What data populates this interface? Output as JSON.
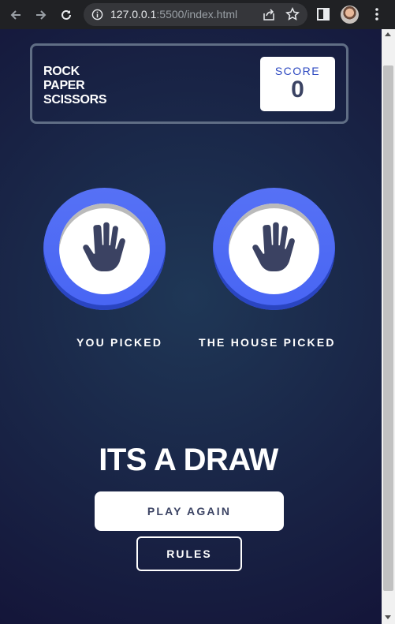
{
  "browser": {
    "url_host": "127.0.0.1",
    "url_rest": ":5500/index.html"
  },
  "header": {
    "logo_lines": [
      "ROCK",
      "PAPER",
      "SCISSORS"
    ],
    "score_label": "SCORE",
    "score_value": "0"
  },
  "game": {
    "you_label": "YOU PICKED",
    "house_label": "THE HOUSE PICKED",
    "you_pick_icon": "paper-hand-icon",
    "house_pick_icon": "paper-hand-icon",
    "result": "ITS A DRAW",
    "play_again_label": "PLAY AGAIN",
    "rules_label": "RULES"
  },
  "colors": {
    "paper_ring": "#5671f5",
    "background_dark": "#141539",
    "background_light": "#1f3756"
  }
}
